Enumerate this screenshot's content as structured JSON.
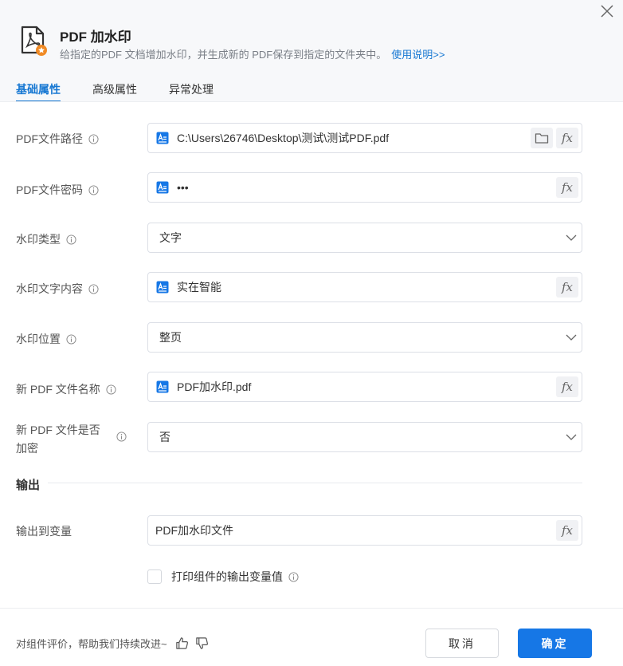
{
  "header": {
    "title": "PDF 加水印",
    "description": "给指定的PDF 文档增加水印，并生成新的 PDF保存到指定的文件夹中。",
    "help_link": "使用说明>>"
  },
  "tabs": [
    {
      "label": "基础属性",
      "active": true
    },
    {
      "label": "高级属性",
      "active": false
    },
    {
      "label": "异常处理",
      "active": false
    }
  ],
  "fields": {
    "pdf_path": {
      "label": "PDF文件路径",
      "value": "C:\\Users\\26746\\Desktop\\测试\\测试PDF.pdf"
    },
    "pdf_password": {
      "label": "PDF文件密码",
      "value": "•••"
    },
    "watermark_type": {
      "label": "水印类型",
      "value": "文字"
    },
    "watermark_text": {
      "label": "水印文字内容",
      "value": "实在智能"
    },
    "watermark_position": {
      "label": "水印位置",
      "value": "整页"
    },
    "new_pdf_name": {
      "label": "新 PDF 文件名称",
      "value": "PDF加水印.pdf"
    },
    "new_pdf_encrypt": {
      "label_line1": "新 PDF 文件是否",
      "label_line2": "加密",
      "value": "否"
    }
  },
  "output": {
    "section_title": "输出",
    "variable": {
      "label": "输出到变量",
      "value": "PDF加水印文件"
    },
    "print_checkbox": {
      "label": "打印组件的输出变量值",
      "checked": false
    }
  },
  "footer": {
    "feedback_text": "对组件评价，帮助我们持续改进~",
    "cancel_label": "取消",
    "ok_label": "确定"
  },
  "fx_label": "fx",
  "colors": {
    "accent": "#1677d2",
    "primary_button": "#1677e6",
    "header_bg": "#f7f8fa",
    "icon_badge": "#f08a24"
  },
  "icons": [
    "close-icon",
    "pdf-app-icon",
    "info-icon",
    "text-variable-icon",
    "folder-icon",
    "fx-icon",
    "chevron-down-icon",
    "thumbs-up-icon",
    "thumbs-down-icon"
  ]
}
